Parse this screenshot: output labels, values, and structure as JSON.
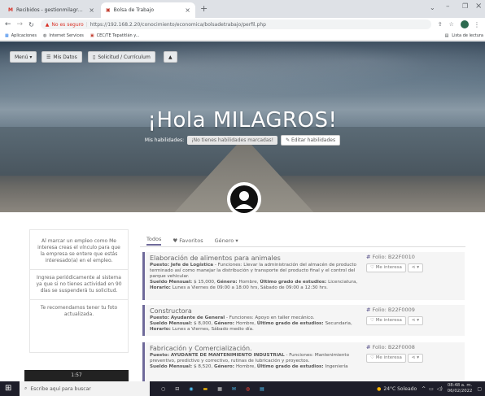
{
  "browser": {
    "tabs": [
      {
        "label": "Recibidos - gestionmilagrosorte@...",
        "active": false
      },
      {
        "label": "Bolsa de Trabajo",
        "active": true
      }
    ],
    "new_tab": "+",
    "url_warning": "No es seguro",
    "url": "https://192.168.2.20/conocimiento/economica/bolsadetrabajo/perfil.php",
    "bookmarks": [
      "Aplicaciones",
      "Internet Services",
      "CEC/TE Tepatitlán y..."
    ],
    "reading_list": "Lista de lectura"
  },
  "nav": {
    "menu": "Menú ▾",
    "datos": "Mis Datos",
    "solicitud": "Solicitud / Currículum",
    "user_icon": "user-icon"
  },
  "hero": {
    "greeting": "¡Hola MILAGROS!",
    "skills_label": "Mis habilidades:",
    "skills_empty": "¡No tienes habilidades marcadas!",
    "edit_skills": "Editar habilidades"
  },
  "left_panel": {
    "p1": "Al marcar un empleo como Me interesa creas el vínculo para que la empresa se entere que estás interesado(a) en el empleo.",
    "p2": "Ingresa periódicamente al sistema ya que si no tienes actividad en 90 días se suspenderá tu solicitud.",
    "p3": "Te recomendamos tener tu foto actualizada.",
    "time": "1:57"
  },
  "job_tabs": [
    "Todos",
    "Favoritos",
    "Género ▾"
  ],
  "jobs": [
    {
      "title": "Elaboración de alimentos para animales",
      "puesto": "Jefe de Logística",
      "funciones": "Llevar la administración del almacén de producto terminado así como manejar la distribución y transporte del producto final y el control del parque vehicular.",
      "sueldo": "$ 15,000",
      "genero": "Hombre",
      "estudios": "Licenciatura",
      "horario": "Lunes a Viernes de 09:00 a 18:00 hrs, Sábado de 09:00 a 12:30 hrs.",
      "folio": "Folio: B22F0010",
      "interes": "Me interesa"
    },
    {
      "title": "Constructora",
      "puesto": "Ayudante de General",
      "funciones": "Apoyo en taller mecánico.",
      "sueldo": "$ 8,000",
      "genero": "Hombre",
      "estudios": "Secundaria",
      "horario": "Lunes a Viernes, Sábado medio día.",
      "folio": "Folio: B22F0009",
      "interes": "Me interesa"
    },
    {
      "title": "Fabricación y Comercialización.",
      "puesto": "AYUDANTE DE MANTENIMIENTO INDUSTRIAL",
      "funciones": "Mantenimiento preventivo, predictivo y correctivo, rutinas de lubricación y proyectos.",
      "sueldo": "$ 8,520",
      "genero": "Hombre",
      "estudios": "Ingeniería",
      "folio": "Folio: B22F0008",
      "interes": "Me interesa"
    }
  ],
  "taskbar": {
    "search": "Escribe aquí para buscar",
    "weather": "24°C Soleado",
    "clock_time": "08:48 a. m.",
    "clock_date": "06/02/2022"
  }
}
